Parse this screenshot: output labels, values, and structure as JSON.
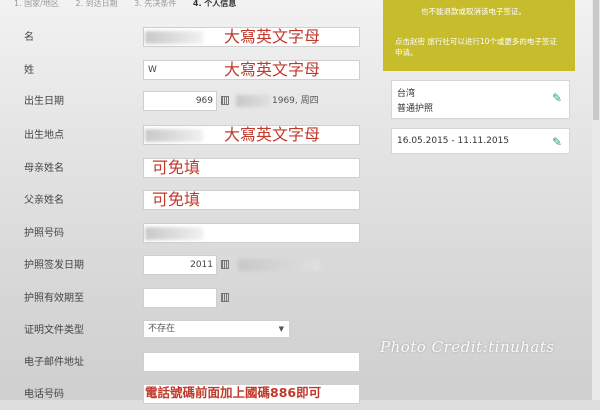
{
  "steps": [
    "1. 国家/地区",
    "2. 到达日期",
    "3. 先决条件",
    "4. 个人信息"
  ],
  "form": {
    "given_name": {
      "label": "名",
      "overlay": "大寫英文字母"
    },
    "surname": {
      "label": "姓",
      "value": "W",
      "overlay": "大寫英文字母"
    },
    "birth_date": {
      "label": "出生日期",
      "value": "969",
      "after": "1969, 周四"
    },
    "birth_place": {
      "label": "出生地点",
      "overlay": "大寫英文字母"
    },
    "mother_name": {
      "label": "母亲姓名",
      "overlay": "可免填"
    },
    "father_name": {
      "label": "父亲姓名",
      "overlay": "可免填"
    },
    "passport_no": {
      "label": "护照号码"
    },
    "passport_issue": {
      "label": "护照签发日期",
      "value": "2011"
    },
    "passport_expiry": {
      "label": "护照有效期至"
    },
    "id_doc_type": {
      "label": "证明文件类型",
      "value": "不存在"
    },
    "email": {
      "label": "电子邮件地址"
    },
    "phone": {
      "label": "电话号码",
      "overlay": "電話號碼前面加上國碼886即可"
    }
  },
  "sidebar": {
    "notice_line1": "也不能退款或取消该电子签证。",
    "notice_line2": "点击赵密 旅行社可以进行10个或更多的电子签证申请。",
    "country_card": {
      "country": "台湾",
      "passport_type": "普通护照"
    },
    "date_card": {
      "range": "16.05.2015 - 11.11.2015"
    }
  },
  "watermark": "Photo Credit:tinuhats"
}
